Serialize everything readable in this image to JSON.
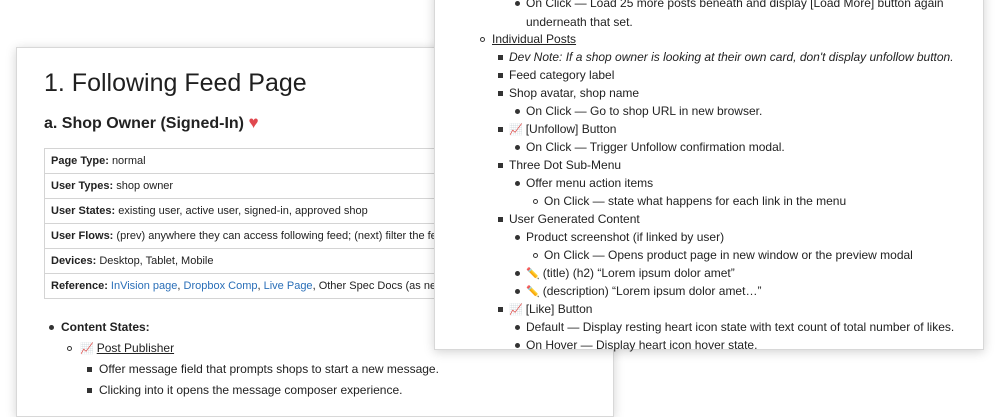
{
  "left_card": {
    "title": "1. Following Feed Page",
    "subtitle": "a. Shop Owner (Signed-In)",
    "heart": "♥",
    "meta": {
      "page_type_label": "Page Type:",
      "page_type_value": "normal",
      "user_types_label": "User Types:",
      "user_types_value": "shop owner",
      "user_states_label": "User States:",
      "user_states_value": "existing user, active user, signed-in, approved shop",
      "user_flows_label": "User Flows:",
      "user_flows_value": "(prev) anywhere they can access following feed; (next) filter the fe",
      "devices_label": "Devices:",
      "devices_value": "Desktop, Tablet, Mobile",
      "reference_label": "Reference:",
      "ref_invision": "InVision page",
      "ref_dropbox": "Dropbox Comp",
      "ref_live": "Live Page",
      "ref_other": "Other Spec Docs (as ne"
    },
    "content_states": "Content States:",
    "post_publisher": "Post Publisher",
    "pp_item1": "Offer message field that prompts shops to start a new message.",
    "pp_item2": "Clicking into it opens the message composer experience."
  },
  "right_card": {
    "top_line1": "On Click — Load 25 more posts beneath and display [Load More] button again",
    "top_line2": "underneath that set.",
    "individual_posts": "Individual Posts",
    "dev_note": "Dev Note: If a shop owner is looking at their own card, don't display unfollow button.",
    "feed_category": "Feed category label",
    "shop_avatar": "Shop avatar, shop name",
    "avatar_onclick": "On Click — Go to shop URL in new browser.",
    "unfollow_button": "[Unfollow] Button",
    "unfollow_onclick": "On Click — Trigger Unfollow confirmation modal.",
    "three_dot": "Three Dot Sub-Menu",
    "offer_menu": "Offer menu action items",
    "menu_onclick": "On Click — state what happens for each link in the menu",
    "ugc": "User Generated Content",
    "product_screenshot": "Product screenshot (if linked by user)",
    "product_onclick": "On Click — Opens product page in new window or the preview modal",
    "title_item": "(title) (h2) “Lorem ipsum dolor amet”",
    "desc_item": "(description) “Lorem ipsum dolor amet…”",
    "like_button": "[Like] Button",
    "like_default": "Default — Display resting heart icon state with text count of total number of likes.",
    "like_hover": "On Hover — Display heart icon hover state."
  },
  "icons": {
    "chart": "📈",
    "pencil": "✏️"
  }
}
